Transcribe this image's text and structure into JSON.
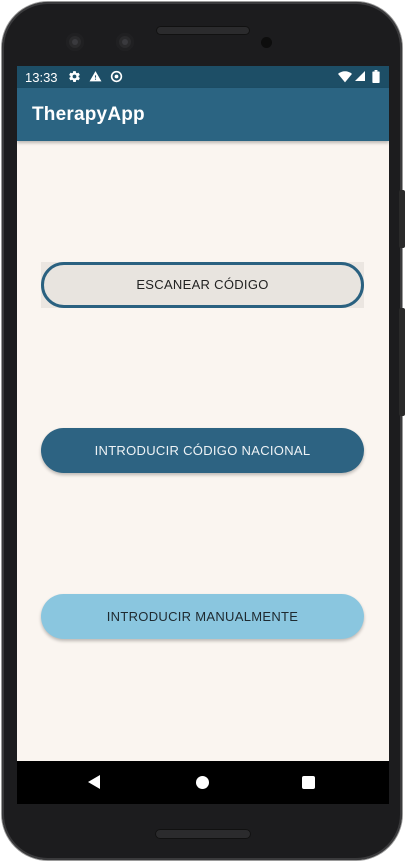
{
  "status_bar": {
    "time": "13:33",
    "icons": [
      "gear-icon",
      "warning-icon",
      "sync-icon"
    ],
    "right_icons": [
      "wifi-icon",
      "signal-icon",
      "battery-icon"
    ]
  },
  "app_bar": {
    "title": "TherapyApp"
  },
  "buttons": {
    "scan_label": "ESCANEAR CÓDIGO",
    "national_label": "INTRODUCIR CÓDIGO NACIONAL",
    "manual_label": "INTRODUCIR MANUALMENTE"
  },
  "navigation": {
    "icons": [
      "back-icon",
      "home-icon",
      "recent-apps-icon"
    ]
  },
  "colors": {
    "app_bar": "#2b6482",
    "status_bar": "#1d4e66",
    "background": "#faf5f0",
    "primary_button": "#2d6382",
    "secondary_button": "#8ac6df",
    "outlined_button_border": "#2a6180"
  }
}
